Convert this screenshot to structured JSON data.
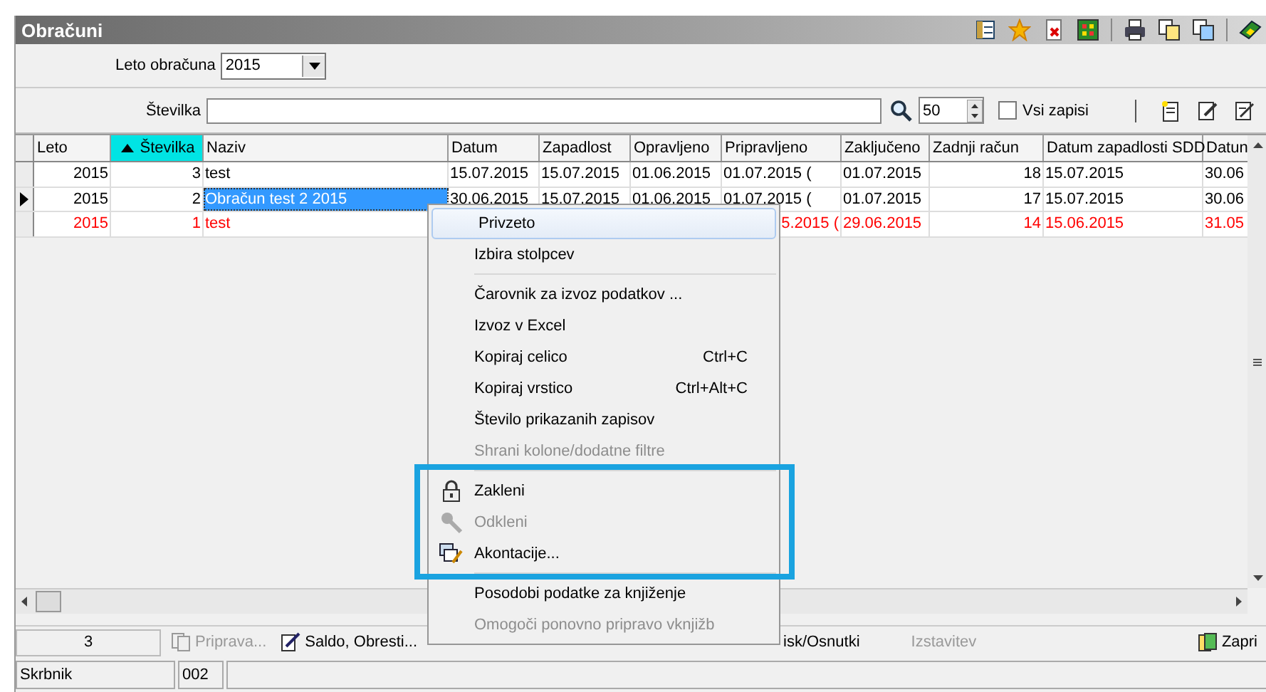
{
  "window": {
    "title": "Obračuni"
  },
  "filters": {
    "year_label": "Leto obračuna",
    "year_value": "2015",
    "number_label": "Številka",
    "records_value": "50",
    "all_records": {
      "label": "Vsi zapisi",
      "checked": false
    }
  },
  "table": {
    "columns": [
      {
        "label": "Leto",
        "sorted": false
      },
      {
        "label": "Številka",
        "sorted": true
      },
      {
        "label": "Naziv",
        "sorted": false
      },
      {
        "label": "Datum",
        "sorted": false
      },
      {
        "label": "Zapadlost",
        "sorted": false
      },
      {
        "label": "Opravljeno",
        "sorted": false
      },
      {
        "label": "Pripravljeno",
        "sorted": false
      },
      {
        "label": "Zaključeno",
        "sorted": false
      },
      {
        "label": "Zadnji račun",
        "sorted": false
      },
      {
        "label": "Datum zapadlosti SDD",
        "sorted": false
      },
      {
        "label": "Datun",
        "sorted": false
      }
    ],
    "rows": [
      {
        "selected": false,
        "color": "#000000",
        "cells": [
          "2015",
          "3",
          "test",
          "15.07.2015",
          "15.07.2015",
          "01.06.2015",
          "01.07.2015 (",
          "01.07.2015",
          "18",
          "15.07.2015",
          "30.06"
        ]
      },
      {
        "selected": true,
        "color": "#000000",
        "cells": [
          "2015",
          "2",
          "Obračun test 2 2015",
          "30.06.2015",
          "15.07.2015",
          "01.06.2015",
          "01.07.2015 (",
          "01.07.2015",
          "17",
          "15.07.2015",
          "30.06"
        ]
      },
      {
        "selected": false,
        "color": "#ff0000",
        "cells": [
          "2015",
          "1",
          "test",
          null,
          null,
          null,
          "5.2015 (",
          "29.06.2015",
          "14",
          "15.06.2015",
          "31.05"
        ]
      }
    ]
  },
  "context_menu": [
    {
      "kind": "item",
      "label": "Privzeto",
      "disabled": false,
      "selected": true
    },
    {
      "kind": "item",
      "label": "Izbira stolpcev",
      "disabled": false,
      "selected": false
    },
    {
      "kind": "separator"
    },
    {
      "kind": "item",
      "label": "Čarovnik za izvoz podatkov ...",
      "disabled": false,
      "selected": false
    },
    {
      "kind": "item",
      "label": "Izvoz v Excel",
      "disabled": false,
      "selected": false
    },
    {
      "kind": "item",
      "label": "Kopiraj celico",
      "shortcut": "Ctrl+C",
      "disabled": false,
      "selected": false
    },
    {
      "kind": "item",
      "label": "Kopiraj vrstico",
      "shortcut": "Ctrl+Alt+C",
      "disabled": false,
      "selected": false
    },
    {
      "kind": "item",
      "label": "Število prikazanih zapisov",
      "disabled": false,
      "selected": false
    },
    {
      "kind": "item",
      "label": "Shrani kolone/dodatne filtre",
      "disabled": true,
      "selected": false
    },
    {
      "kind": "separator"
    },
    {
      "kind": "iconitem",
      "label": "Zakleni",
      "disabled": false,
      "selected": false
    },
    {
      "kind": "iconitem",
      "label": "Odkleni",
      "disabled": true,
      "selected": false
    },
    {
      "kind": "iconitem",
      "label": "Akontacije...",
      "disabled": false,
      "selected": false
    },
    {
      "kind": "separator"
    },
    {
      "kind": "item",
      "label": "Posodobi podatke za knjiženje",
      "disabled": false,
      "selected": false
    },
    {
      "kind": "item",
      "label": "Omogoči ponovno pripravo vknjižb",
      "disabled": true,
      "selected": false
    }
  ],
  "bottom_toolbar": {
    "count": "3",
    "buttons": [
      {
        "label": "Priprava...",
        "disabled": true
      },
      {
        "label": "Saldo, Obresti...",
        "disabled": false
      }
    ],
    "right_buttons": [
      {
        "label": "isk/Osnutki",
        "disabled": false
      },
      {
        "label": "Izstavitev",
        "disabled": true
      },
      {
        "label": "Zapri",
        "disabled": false
      }
    ]
  },
  "status_bar": {
    "label": "Skrbnik",
    "value": "002"
  }
}
